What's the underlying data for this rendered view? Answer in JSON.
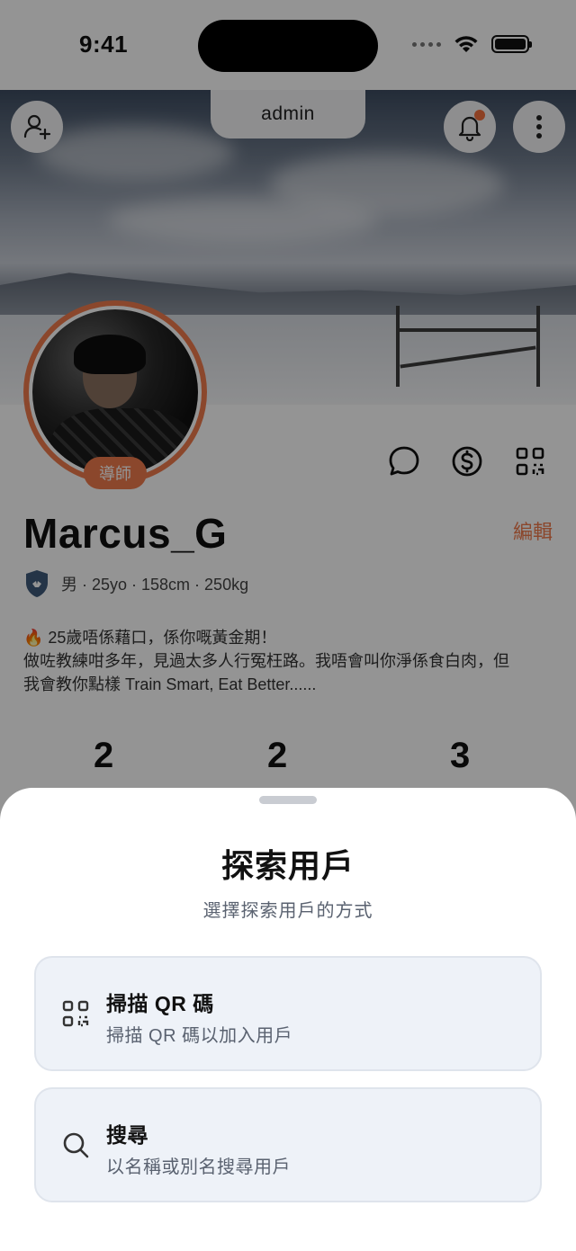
{
  "status_bar": {
    "time": "9:41"
  },
  "header": {
    "center_tab": "admin"
  },
  "profile": {
    "role_badge": "導師",
    "username": "Marcus_G",
    "edit_label": "編輯",
    "meta": "男 · 25yo · 158cm · 250kg",
    "bio_line1": "🔥 25歲唔係藉口，係你嘅黃金期！",
    "bio_line2": "做咗教練咁多年，見過太多人行冤枉路。我唔會叫你淨係食白肉，但",
    "bio_line3": "我會教你點樣 Train Smart, Eat Better......",
    "stats": [
      "2",
      "2",
      "3"
    ]
  },
  "sheet": {
    "title": "探索用戶",
    "subtitle": "選擇探索用戶的方式",
    "options": [
      {
        "title": "掃描 QR 碼",
        "desc": "掃描 QR 碼以加入用戶",
        "icon": "qr-scan-icon"
      },
      {
        "title": "搜尋",
        "desc": "以名稱或別名搜尋用戶",
        "icon": "search-icon"
      }
    ]
  },
  "colors": {
    "accent": "#f07a4d",
    "sheet_option_bg": "#eef2f8",
    "overlay": "rgba(0,0,0,0.42)"
  }
}
